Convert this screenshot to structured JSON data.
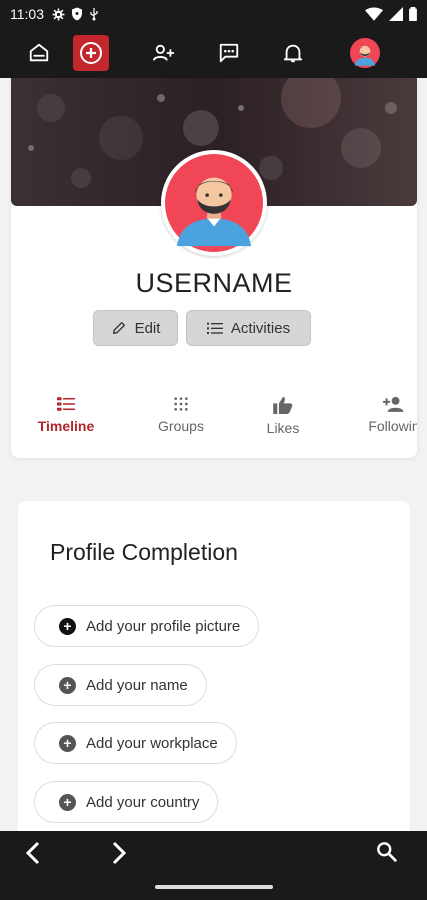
{
  "status_bar": {
    "time": "11:03"
  },
  "profile": {
    "username": "USERNAME",
    "edit_label": "Edit",
    "activities_label": "Activities"
  },
  "tabs": [
    {
      "label": "Timeline",
      "icon": "timeline-icon",
      "active": true
    },
    {
      "label": "Groups",
      "icon": "groups-icon",
      "active": false
    },
    {
      "label": "Likes",
      "icon": "thumb-up-icon",
      "active": false
    },
    {
      "label": "Followin",
      "icon": "person-add-icon",
      "active": false
    }
  ],
  "completion": {
    "title": "Profile Completion",
    "items": [
      "Add your profile picture",
      "Add your name",
      "Add your workplace",
      "Add your country"
    ]
  },
  "colors": {
    "accent": "#c4262e",
    "bar": "#1a1a1a",
    "active_tab": "#b0282c"
  }
}
